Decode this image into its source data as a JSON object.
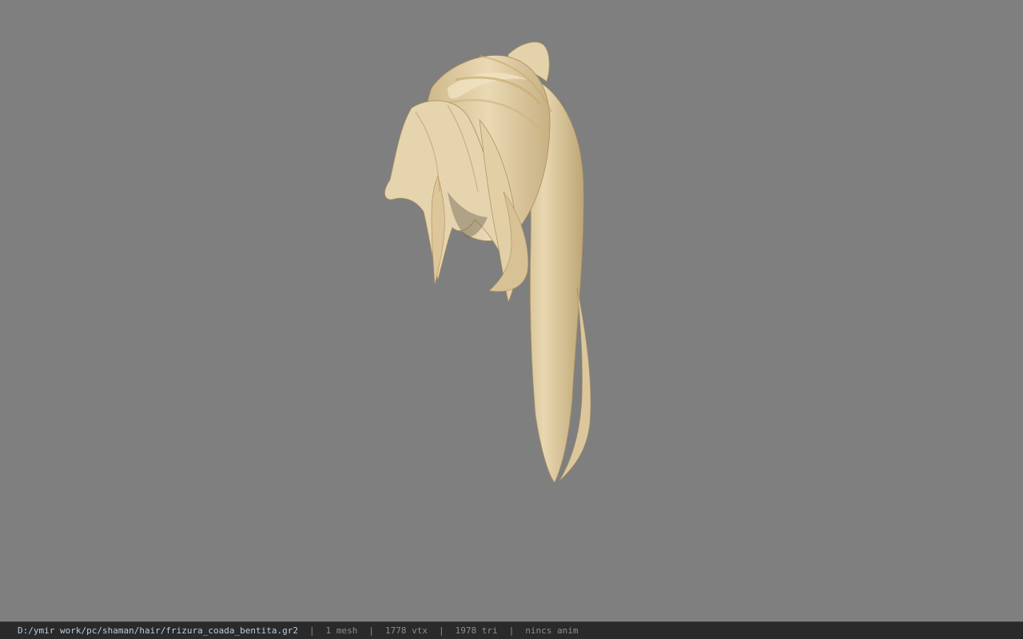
{
  "viewport": {
    "background": "#7f7f7f",
    "model_subject": "ponytail-hairstyle-mesh",
    "hair_color": "#e2cfa6"
  },
  "statusbar": {
    "file_path": "D:/ymir work/pc/shaman/hair/frizura_coada_bentita.gr2",
    "separator": "|",
    "mesh_count": "1 mesh",
    "vertex_count": "1778 vtx",
    "triangle_count": "1978 tri",
    "anim_status": "nincs anim"
  }
}
